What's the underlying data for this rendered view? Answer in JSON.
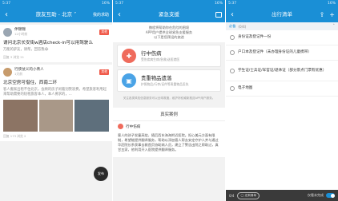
{
  "phone1": {
    "status": {
      "left": "5:37",
      "right": "16%"
    },
    "nav": {
      "back": "‹",
      "title": "旅友互助 - 北京 ˅",
      "right": "我的求助"
    },
    "posts": [
      {
        "user": "伴锦锦",
        "time": "12小时前",
        "tag": "其他",
        "title": "请问北京长安街w酒店check-in可以用驾驶么",
        "body": "万能的驴友，请帮，回答我😂",
        "meta": "回复 3    浏览 21"
      },
      {
        "user": "行侠仗义的小青人",
        "time": "1天前",
        "tag": "其他",
        "title": "北京空房可借住，西南二环",
        "body": "客人搬家出租不住北京，会顾的房子闲着别赞浪费，希望旅客利用起来帮助需要的短租旅客本人，本人要求的，...",
        "meta": "回复 173    浏览 2"
      }
    ],
    "fab": "发布"
  },
  "phone2": {
    "status": {
      "left": "5:37",
      "right": "16%"
    },
    "nav": {
      "back": "‹",
      "title": "紧急支援"
    },
    "notice": "携程将帮助你在危险的困境\nAPP用户提供全球紧急支援服务\n以下是您预设的旅途",
    "cards": [
      {
        "icon": "✚",
        "title": "行中伤病",
        "sub": "受伤疾病生病/急救/送医就医"
      },
      {
        "icon": "▣",
        "title": "贵重物品遗落",
        "sub": "护照物品/行李/证件等贵重物品丢失"
      }
    ],
    "foot": "关注各类风险信息服务可以全球救援，维护好权威新推送APP用户服务。",
    "case_header": "真实案例",
    "case_tag": "行中伤病",
    "case_body": "客人的孩子发童高烧，随后西东海海附近医院。担心美元方面有限制，希望能提供翻译服务，帮助以添加客人帮去安定疗护人并与通过华莊院长系获事去救首页协助病人员，建立了警告出院之帮助过，真甘五家，他利用开入医院提供翻译服务。"
  },
  "phone3": {
    "status": {
      "left": "5:37",
      "right": "16%"
    },
    "nav": {
      "back": "‹",
      "title": "出行清单"
    },
    "section": {
      "label": "必备",
      "count": "(0/4)"
    },
    "items": [
      "身份证及登记件一份",
      "户口本及登记件（未办理身份证的儿童携带）",
      "学生证/士兵证/军官证/退休证（部分景点门票有优惠）",
      "电子地图"
    ],
    "bottom": {
      "count": "0/4",
      "pill": "◯ 还剩清单",
      "right_label": "仅看未完成"
    }
  }
}
